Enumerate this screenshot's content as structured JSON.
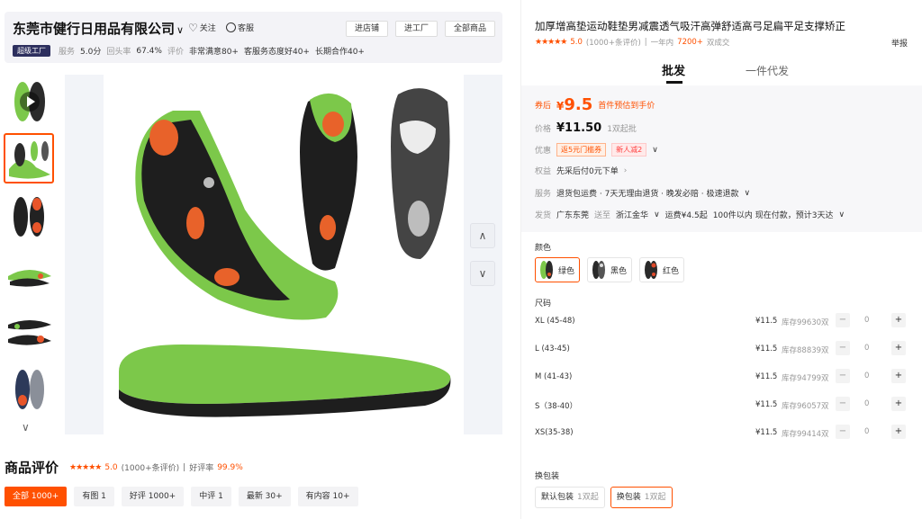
{
  "shop": {
    "name": "东莞市健行日用品有限公司",
    "chevron": "∨",
    "follow_label": "关注",
    "service_label": "客服",
    "buttons": [
      "进店铺",
      "进工厂",
      "全部商品"
    ],
    "badge": "超级工厂",
    "stats": [
      {
        "label": "服务",
        "value": "5.0分"
      },
      {
        "label": "回头率",
        "value": "67.4%"
      },
      {
        "label": "评价",
        "value": ""
      },
      {
        "label": "",
        "value": "非常满意80+"
      },
      {
        "label": "",
        "value": "客服务态度好40+"
      },
      {
        "label": "",
        "value": "长期合作40+"
      }
    ]
  },
  "gallery": {
    "thumb_count": 6,
    "selected_index": 1,
    "up_arrow": "∧",
    "down_arrow": "∨",
    "thumbs_down": "∨"
  },
  "reviews": {
    "title": "商品评价",
    "stars": "★★★★★",
    "score": "5.0",
    "count": "(1000+条评价)",
    "sep": "|",
    "good_rate_label": "好评率",
    "good_rate": "99.9%",
    "tabs": [
      "全部 1000+",
      "有图 1",
      "好评 1000+",
      "中评 1",
      "最新 30+",
      "有内容 10+"
    ]
  },
  "product": {
    "title": "加厚增高垫运动鞋垫男减震透气吸汗高弹舒适高弓足扁平足支撑矫正",
    "stars": "★★★★★",
    "score": "5.0",
    "reviews": "(1000+条评价)",
    "sep": "|",
    "sales_prefix": "一年内",
    "sales_num": "7200+",
    "sales_suffix": "双成交",
    "report": "举报",
    "modes": [
      "批发",
      "一件代发"
    ]
  },
  "pricing": {
    "coupon_label": "券后",
    "coupon_currency": "¥",
    "coupon_price": "9.5",
    "coupon_note": "首件预估到手价",
    "price_label": "价格",
    "price": "¥11.50",
    "moq": "1双起批",
    "promo_label": "优惠",
    "promo_tags": [
      "返5元门槛券",
      "新人减2"
    ],
    "rights_label": "权益",
    "rights": "先采后付0元下单",
    "service_label": "服务",
    "services": "退货包运费 · 7天无理由退货 · 晚发必赔 · 极速退款",
    "ship_label": "发货",
    "ship_from": "广东东莞",
    "ship_to_word": "送至",
    "ship_to": "浙江金华",
    "ship_fee": "运费¥4.5起",
    "ship_time": "100件以内  现在付款，预计3天达"
  },
  "colors": {
    "label": "颜色",
    "options": [
      {
        "name": "绿色",
        "swatch": "#7cc84a"
      },
      {
        "name": "黑色",
        "swatch": "#2a2a2a"
      },
      {
        "name": "红色",
        "swatch": "#e04a2a"
      }
    ]
  },
  "sizes": {
    "label": "尺码",
    "rows": [
      {
        "name": "XL (45-48)",
        "price": "¥11.5",
        "stock": "库存99630双",
        "qty": "0"
      },
      {
        "name": "L (43-45)",
        "price": "¥11.5",
        "stock": "库存88839双",
        "qty": "0"
      },
      {
        "name": "M (41-43)",
        "price": "¥11.5",
        "stock": "库存94799双",
        "qty": "0"
      },
      {
        "name": "S（38-40）",
        "price": "¥11.5",
        "stock": "库存96057双",
        "qty": "0"
      },
      {
        "name": "XS(35-38)",
        "price": "¥11.5",
        "stock": "库存99414双",
        "qty": "0"
      }
    ],
    "minus": "−",
    "plus": "+"
  },
  "packaging": {
    "label": "换包装",
    "options": [
      {
        "name": "默认包装",
        "moq": "1双起"
      },
      {
        "name": "换包装",
        "moq": "1双起"
      }
    ]
  }
}
